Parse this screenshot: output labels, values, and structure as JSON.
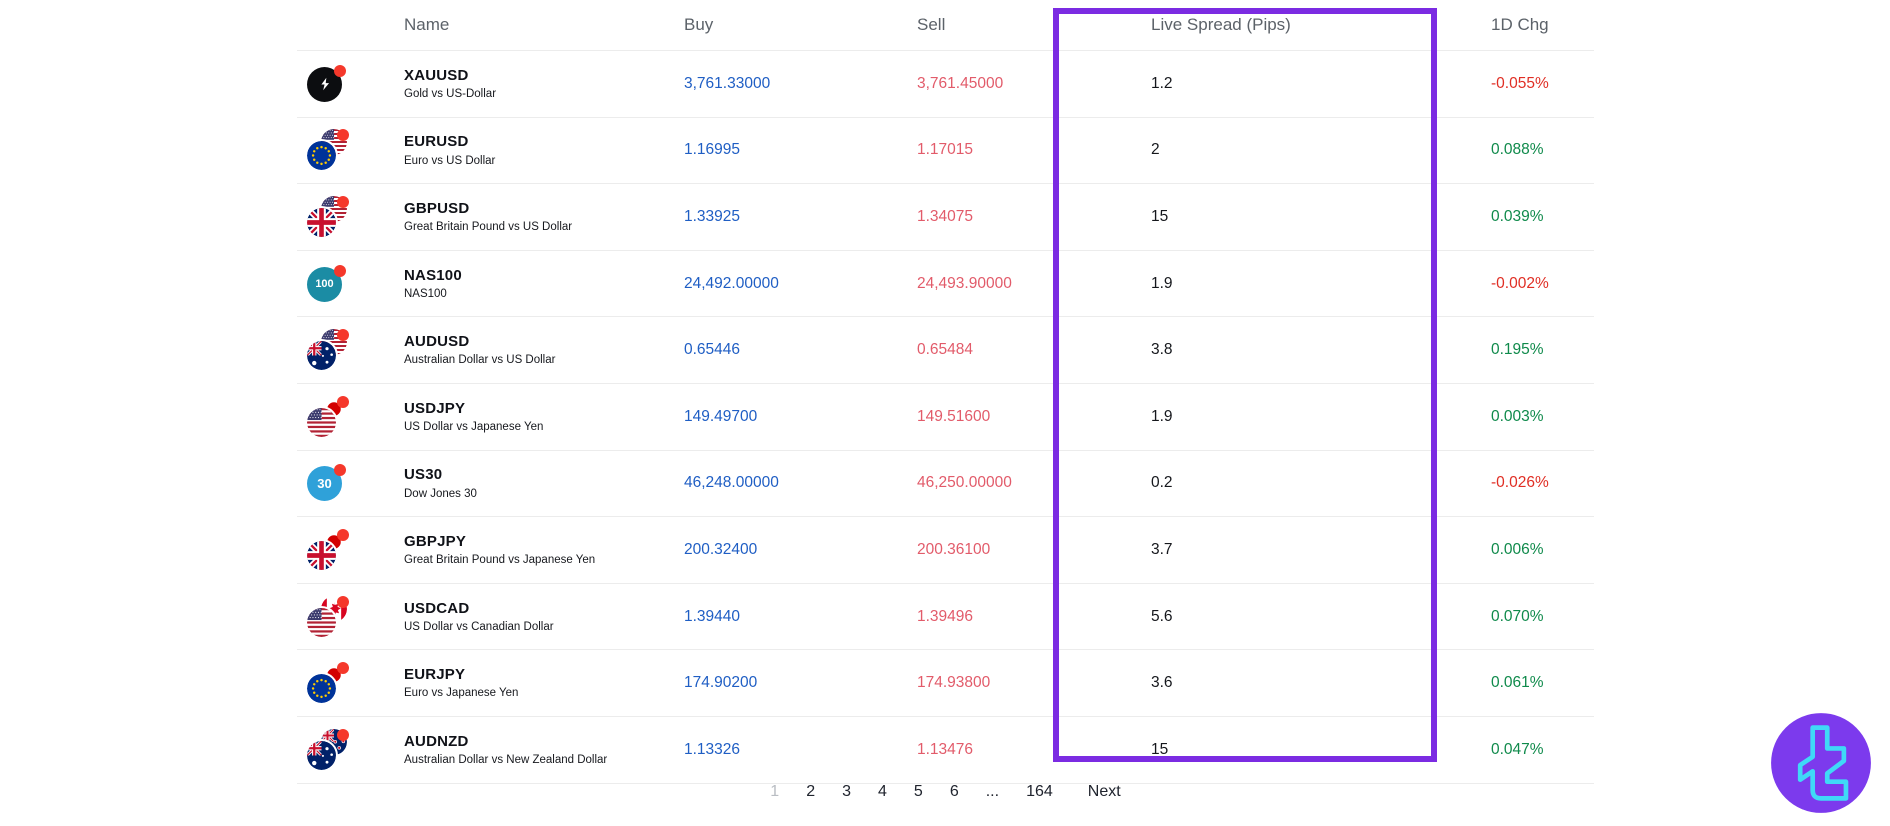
{
  "table": {
    "columns": [
      "Name",
      "Buy",
      "Sell",
      "Live Spread (Pips)",
      "1D Chg"
    ],
    "rows": [
      {
        "symbol": "XAUUSD",
        "description": "Gold vs US-Dollar",
        "buy": "3,761.33000",
        "sell": "3,761.45000",
        "spread": "1.2",
        "change": "-0.055%",
        "change_dir": "down",
        "icon": {
          "kind": "single",
          "bg": "#0c0d10",
          "glyph": "bolt"
        }
      },
      {
        "symbol": "EURUSD",
        "description": "Euro vs US Dollar",
        "buy": "1.16995",
        "sell": "1.17015",
        "spread": "2",
        "change": "0.088%",
        "change_dir": "up",
        "icon": {
          "kind": "pair",
          "base": "eu",
          "quote": "us"
        }
      },
      {
        "symbol": "GBPUSD",
        "description": "Great Britain Pound vs US Dollar",
        "buy": "1.33925",
        "sell": "1.34075",
        "spread": "15",
        "change": "0.039%",
        "change_dir": "up",
        "icon": {
          "kind": "pair",
          "base": "gb",
          "quote": "us"
        }
      },
      {
        "symbol": "NAS100",
        "description": "NAS100",
        "buy": "24,492.00000",
        "sell": "24,493.90000",
        "spread": "1.9",
        "change": "-0.002%",
        "change_dir": "down",
        "icon": {
          "kind": "single",
          "bg": "#1b8ca4",
          "glyph": "100"
        }
      },
      {
        "symbol": "AUDUSD",
        "description": "Australian Dollar vs US Dollar",
        "buy": "0.65446",
        "sell": "0.65484",
        "spread": "3.8",
        "change": "0.195%",
        "change_dir": "up",
        "icon": {
          "kind": "pair",
          "base": "au",
          "quote": "us"
        }
      },
      {
        "symbol": "USDJPY",
        "description": "US Dollar vs Japanese Yen",
        "buy": "149.49700",
        "sell": "149.51600",
        "spread": "1.9",
        "change": "0.003%",
        "change_dir": "up",
        "icon": {
          "kind": "pair",
          "base": "us",
          "quote": "jp"
        }
      },
      {
        "symbol": "US30",
        "description": "Dow Jones 30",
        "buy": "46,248.00000",
        "sell": "46,250.00000",
        "spread": "0.2",
        "change": "-0.026%",
        "change_dir": "down",
        "icon": {
          "kind": "single",
          "bg": "#2fa1d9",
          "glyph": "30"
        }
      },
      {
        "symbol": "GBPJPY",
        "description": "Great Britain Pound vs Japanese Yen",
        "buy": "200.32400",
        "sell": "200.36100",
        "spread": "3.7",
        "change": "0.006%",
        "change_dir": "up",
        "icon": {
          "kind": "pair",
          "base": "gb",
          "quote": "jp"
        }
      },
      {
        "symbol": "USDCAD",
        "description": "US Dollar vs Canadian Dollar",
        "buy": "1.39440",
        "sell": "1.39496",
        "spread": "5.6",
        "change": "0.070%",
        "change_dir": "up",
        "icon": {
          "kind": "pair",
          "base": "us",
          "quote": "ca"
        }
      },
      {
        "symbol": "EURJPY",
        "description": "Euro vs Japanese Yen",
        "buy": "174.90200",
        "sell": "174.93800",
        "spread": "3.6",
        "change": "0.061%",
        "change_dir": "up",
        "icon": {
          "kind": "pair",
          "base": "eu",
          "quote": "jp"
        }
      },
      {
        "symbol": "AUDNZD",
        "description": "Australian Dollar vs New Zealand Dollar",
        "buy": "1.13326",
        "sell": "1.13476",
        "spread": "15",
        "change": "0.047%",
        "change_dir": "up",
        "icon": {
          "kind": "pair",
          "base": "au",
          "quote": "nz"
        }
      }
    ]
  },
  "pagination": {
    "pages": [
      "1",
      "2",
      "3",
      "4",
      "5",
      "6",
      "...",
      "164"
    ],
    "current": "1",
    "next_label": "Next"
  },
  "annotation": {
    "highlighted_column": "Live Spread (Pips)",
    "color": "#7b2be2"
  },
  "colors": {
    "buy": "#1f5ec4",
    "sell": "#e25b6a",
    "change_up": "#0f8a4b",
    "change_down": "#e02e24",
    "accent": "#7b2be2",
    "logo_bg": "#7c3aed",
    "logo_glyph": "#3fd9f7",
    "badge": "#f5382b"
  }
}
